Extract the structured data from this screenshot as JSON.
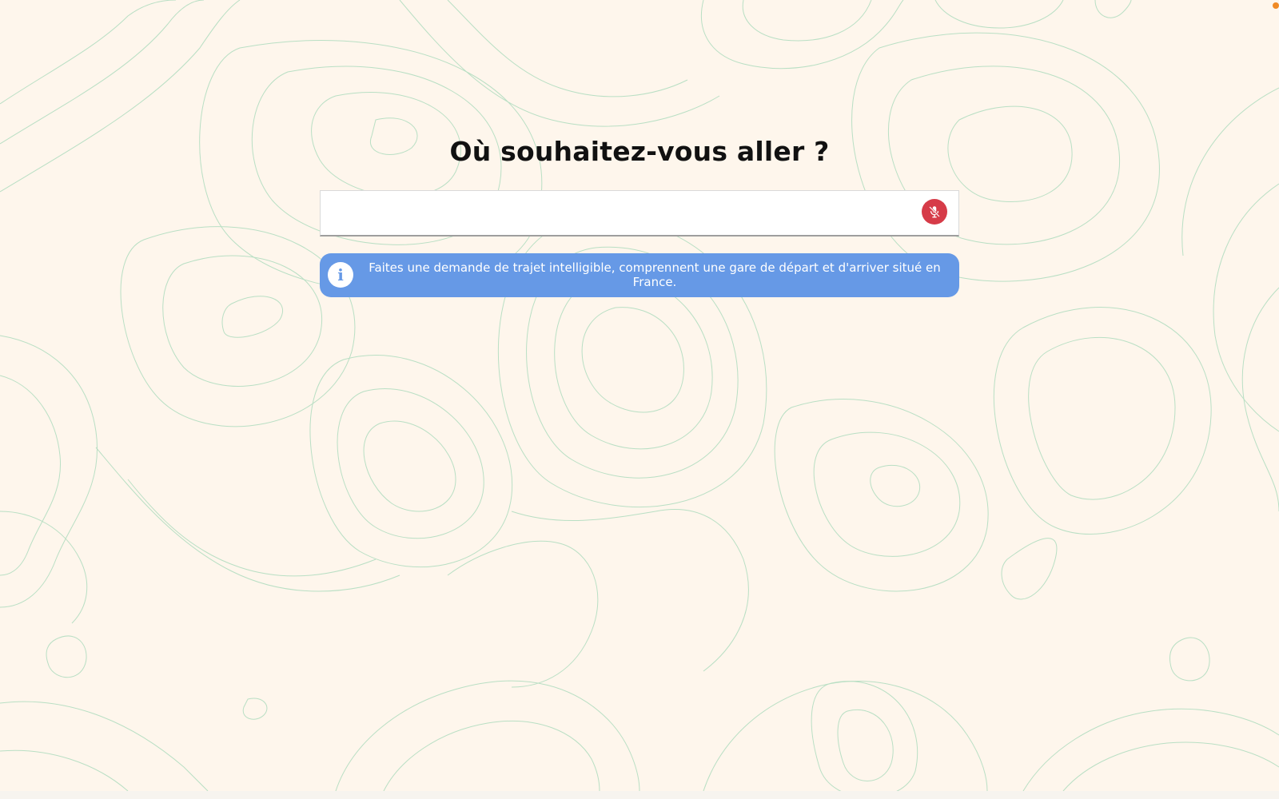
{
  "page": {
    "title": "Où souhaitez-vous aller ?"
  },
  "search": {
    "value": "",
    "placeholder": "",
    "mic_icon": "microphone-off-icon",
    "mic_color": "#d63b48"
  },
  "info_banner": {
    "icon": "info-icon",
    "icon_glyph": "i",
    "message": "Faites une demande de trajet intelligible, comprennent une gare de départ et d'arriver situé en France.",
    "color": "#6699e6"
  },
  "theme": {
    "background": "#fef6ec",
    "contour_color": "#b9dfc4"
  }
}
